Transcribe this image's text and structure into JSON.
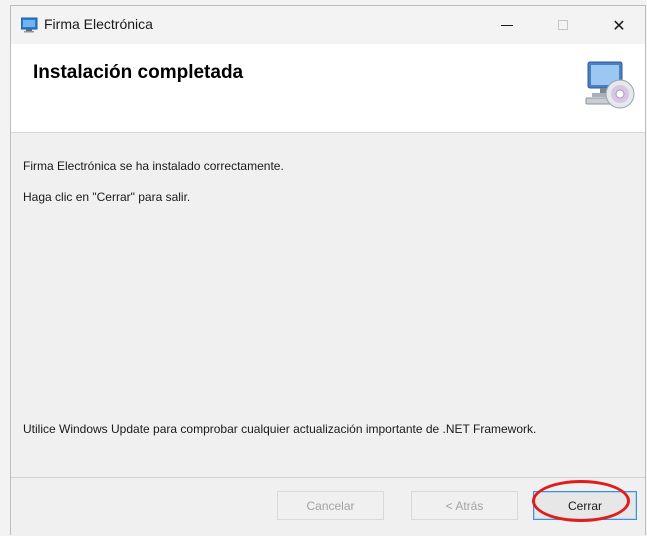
{
  "window": {
    "title": "Firma Electrónica"
  },
  "header": {
    "title": "Instalación completada"
  },
  "content": {
    "line1": "Firma Electrónica se ha instalado correctamente.",
    "line2": "Haga clic en \"Cerrar\" para salir.",
    "line3": "Utilice Windows Update para comprobar cualquier actualización importante de .NET Framework."
  },
  "footer": {
    "cancel_label": "Cancelar",
    "back_label": "< Atrás",
    "close_label": "Cerrar"
  },
  "title_controls": {
    "close_glyph": "✕"
  },
  "colors": {
    "highlight": "#e21b1b",
    "focus_border": "#3c8fd8"
  }
}
